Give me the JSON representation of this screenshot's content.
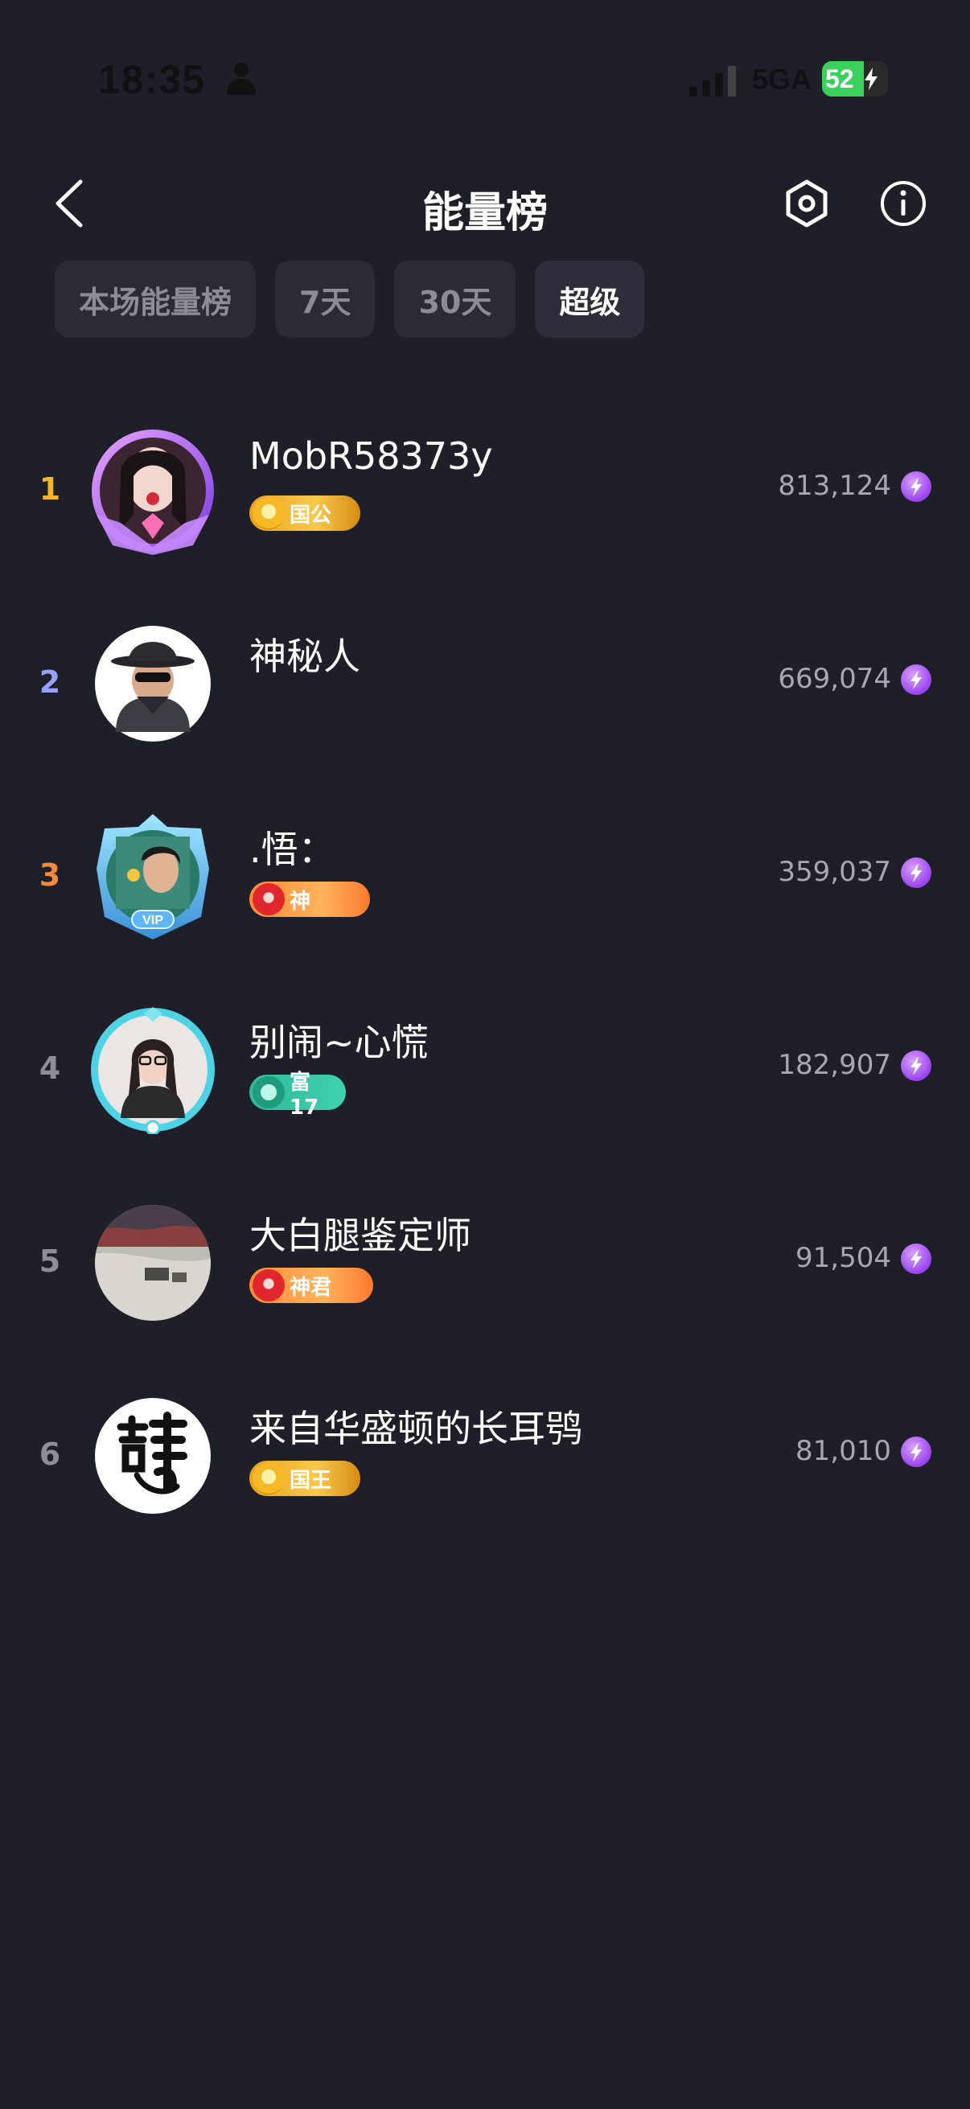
{
  "status_bar": {
    "time": "18:35",
    "network": "5GA",
    "battery": "52"
  },
  "header": {
    "title": "能量榜"
  },
  "tabs": [
    {
      "label": "本场能量榜",
      "active": false
    },
    {
      "label": "7天",
      "active": false
    },
    {
      "label": "30天",
      "active": false
    },
    {
      "label": "超级",
      "active": true
    }
  ],
  "leaderboard": [
    {
      "rank": "1",
      "name": "MobR58373y",
      "badge": "国公",
      "score": "813,124"
    },
    {
      "rank": "2",
      "name": "神秘人",
      "badge": "",
      "score": "669,074"
    },
    {
      "rank": "3",
      "name": ".悟：",
      "badge": "神",
      "score": "359,037"
    },
    {
      "rank": "4",
      "name": "别闹~心慌",
      "badge": "富17",
      "score": "182,907"
    },
    {
      "rank": "5",
      "name": "大白腿鉴定师",
      "badge": "神君",
      "score": "91,504"
    },
    {
      "rank": "6",
      "name": "来自华盛顿的长耳鸮",
      "badge": "国王",
      "score": "81,010"
    }
  ],
  "colors": {
    "background": "#1f1f29",
    "rank1": "#f5b528",
    "rank2": "#9aa0ff",
    "rank3": "#f08a3c",
    "rank_other": "#8e8e98",
    "energy": "#9b43ee"
  }
}
